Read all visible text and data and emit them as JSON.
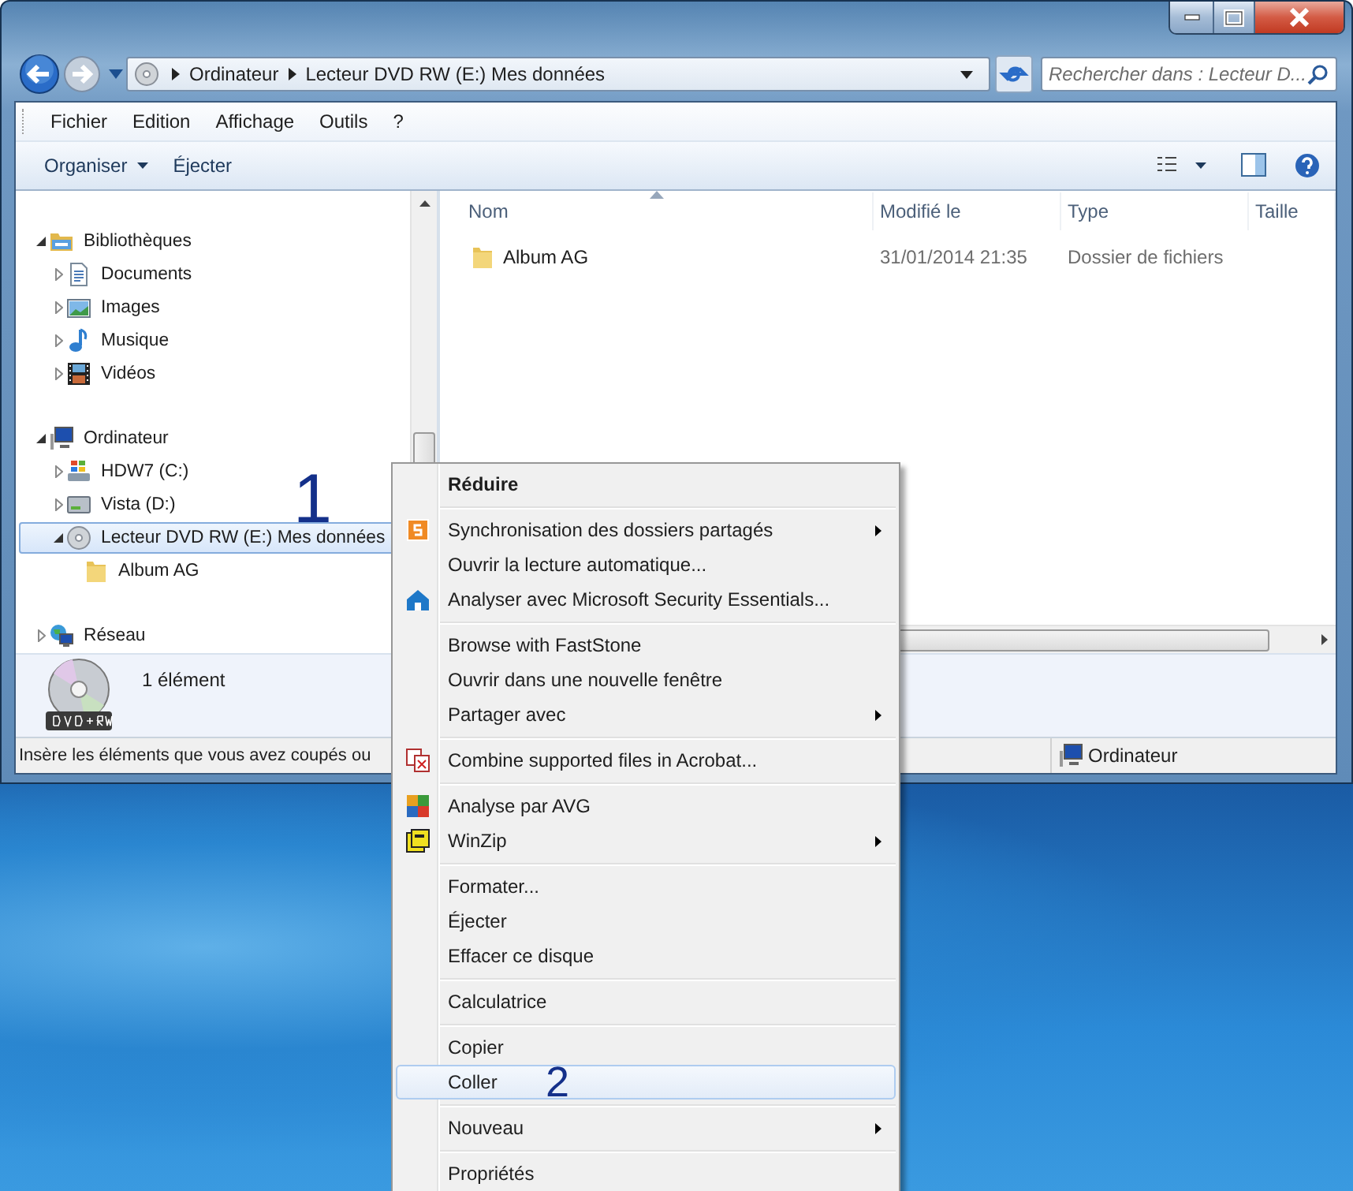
{
  "address_bar": {
    "breadcrumbs": [
      "Ordinateur",
      "Lecteur DVD RW (E:) Mes données"
    ]
  },
  "search": {
    "placeholder": "Rechercher dans : Lecteur D..."
  },
  "menu_bar": [
    "Fichier",
    "Edition",
    "Affichage",
    "Outils",
    "?"
  ],
  "toolbar": [
    {
      "label": "Organiser",
      "dropdown": true
    },
    {
      "label": "Éjecter",
      "dropdown": false
    }
  ],
  "nav_tree": [
    {
      "label": "Bibliothèques",
      "expanded": true,
      "selected": false,
      "children": [
        {
          "label": "Documents",
          "expanded": false,
          "selected": false
        },
        {
          "label": "Images",
          "expanded": false,
          "selected": false
        },
        {
          "label": "Musique",
          "expanded": false,
          "selected": false
        },
        {
          "label": "Vidéos",
          "expanded": false,
          "selected": false
        }
      ]
    },
    {
      "label": "Ordinateur",
      "expanded": true,
      "selected": false,
      "children": [
        {
          "label": "HDW7 (C:)",
          "expanded": false,
          "selected": false
        },
        {
          "label": "Vista (D:)",
          "expanded": false,
          "selected": false
        },
        {
          "label": "Lecteur DVD RW (E:) Mes données",
          "expanded": true,
          "selected": true,
          "annotation": "1",
          "children": [
            {
              "label": "Album AG",
              "selected": false
            }
          ]
        }
      ]
    },
    {
      "label": "Réseau",
      "expanded": false,
      "selected": false
    }
  ],
  "files": {
    "columns": [
      {
        "label": "Nom",
        "sorted": true
      },
      {
        "label": "Modifié le",
        "sorted": false
      },
      {
        "label": "Type",
        "sorted": false
      },
      {
        "label": "Taille",
        "sorted": false
      }
    ],
    "rows": [
      {
        "name": "Album AG",
        "modified": "31/01/2014 21:35",
        "type": "Dossier de fichiers"
      }
    ]
  },
  "details": {
    "count": "1 élément"
  },
  "status_bar": {
    "text": "Insère les éléments que vous avez coupés ou",
    "location": "Ordinateur"
  },
  "context_menu": [
    {
      "kind": "item",
      "label": "Réduire",
      "default": true,
      "submenu": false,
      "selected": false
    },
    {
      "kind": "separator"
    },
    {
      "kind": "item",
      "label": "Synchronisation des dossiers partagés",
      "default": false,
      "submenu": true,
      "selected": false
    },
    {
      "kind": "item",
      "label": "Ouvrir la lecture automatique...",
      "default": false,
      "submenu": false,
      "selected": false
    },
    {
      "kind": "item",
      "label": "Analyser avec Microsoft Security Essentials...",
      "default": false,
      "submenu": false,
      "selected": false
    },
    {
      "kind": "separator"
    },
    {
      "kind": "item",
      "label": "Browse with FastStone",
      "default": false,
      "submenu": false,
      "selected": false
    },
    {
      "kind": "item",
      "label": "Ouvrir dans une nouvelle fenêtre",
      "default": false,
      "submenu": false,
      "selected": false
    },
    {
      "kind": "item",
      "label": "Partager avec",
      "default": false,
      "submenu": true,
      "selected": false
    },
    {
      "kind": "separator"
    },
    {
      "kind": "item",
      "label": "Combine supported files in Acrobat...",
      "default": false,
      "submenu": false,
      "selected": false
    },
    {
      "kind": "separator"
    },
    {
      "kind": "item",
      "label": "Analyse par AVG",
      "default": false,
      "submenu": false,
      "selected": false
    },
    {
      "kind": "item",
      "label": "WinZip",
      "default": false,
      "submenu": true,
      "selected": false
    },
    {
      "kind": "separator"
    },
    {
      "kind": "item",
      "label": "Formater...",
      "default": false,
      "submenu": false,
      "selected": false
    },
    {
      "kind": "item",
      "label": "Éjecter",
      "default": false,
      "submenu": false,
      "selected": false
    },
    {
      "kind": "item",
      "label": "Effacer ce disque",
      "default": false,
      "submenu": false,
      "selected": false
    },
    {
      "kind": "separator"
    },
    {
      "kind": "item",
      "label": "Calculatrice",
      "default": false,
      "submenu": false,
      "selected": false
    },
    {
      "kind": "separator"
    },
    {
      "kind": "item",
      "label": "Copier",
      "default": false,
      "submenu": false,
      "selected": false
    },
    {
      "kind": "item",
      "label": "Coller",
      "default": false,
      "submenu": false,
      "selected": true,
      "annotation": "2"
    },
    {
      "kind": "separator"
    },
    {
      "kind": "item",
      "label": "Nouveau",
      "default": false,
      "submenu": true,
      "selected": false
    },
    {
      "kind": "separator"
    },
    {
      "kind": "item",
      "label": "Propriétés",
      "default": false,
      "submenu": false,
      "selected": false
    }
  ]
}
